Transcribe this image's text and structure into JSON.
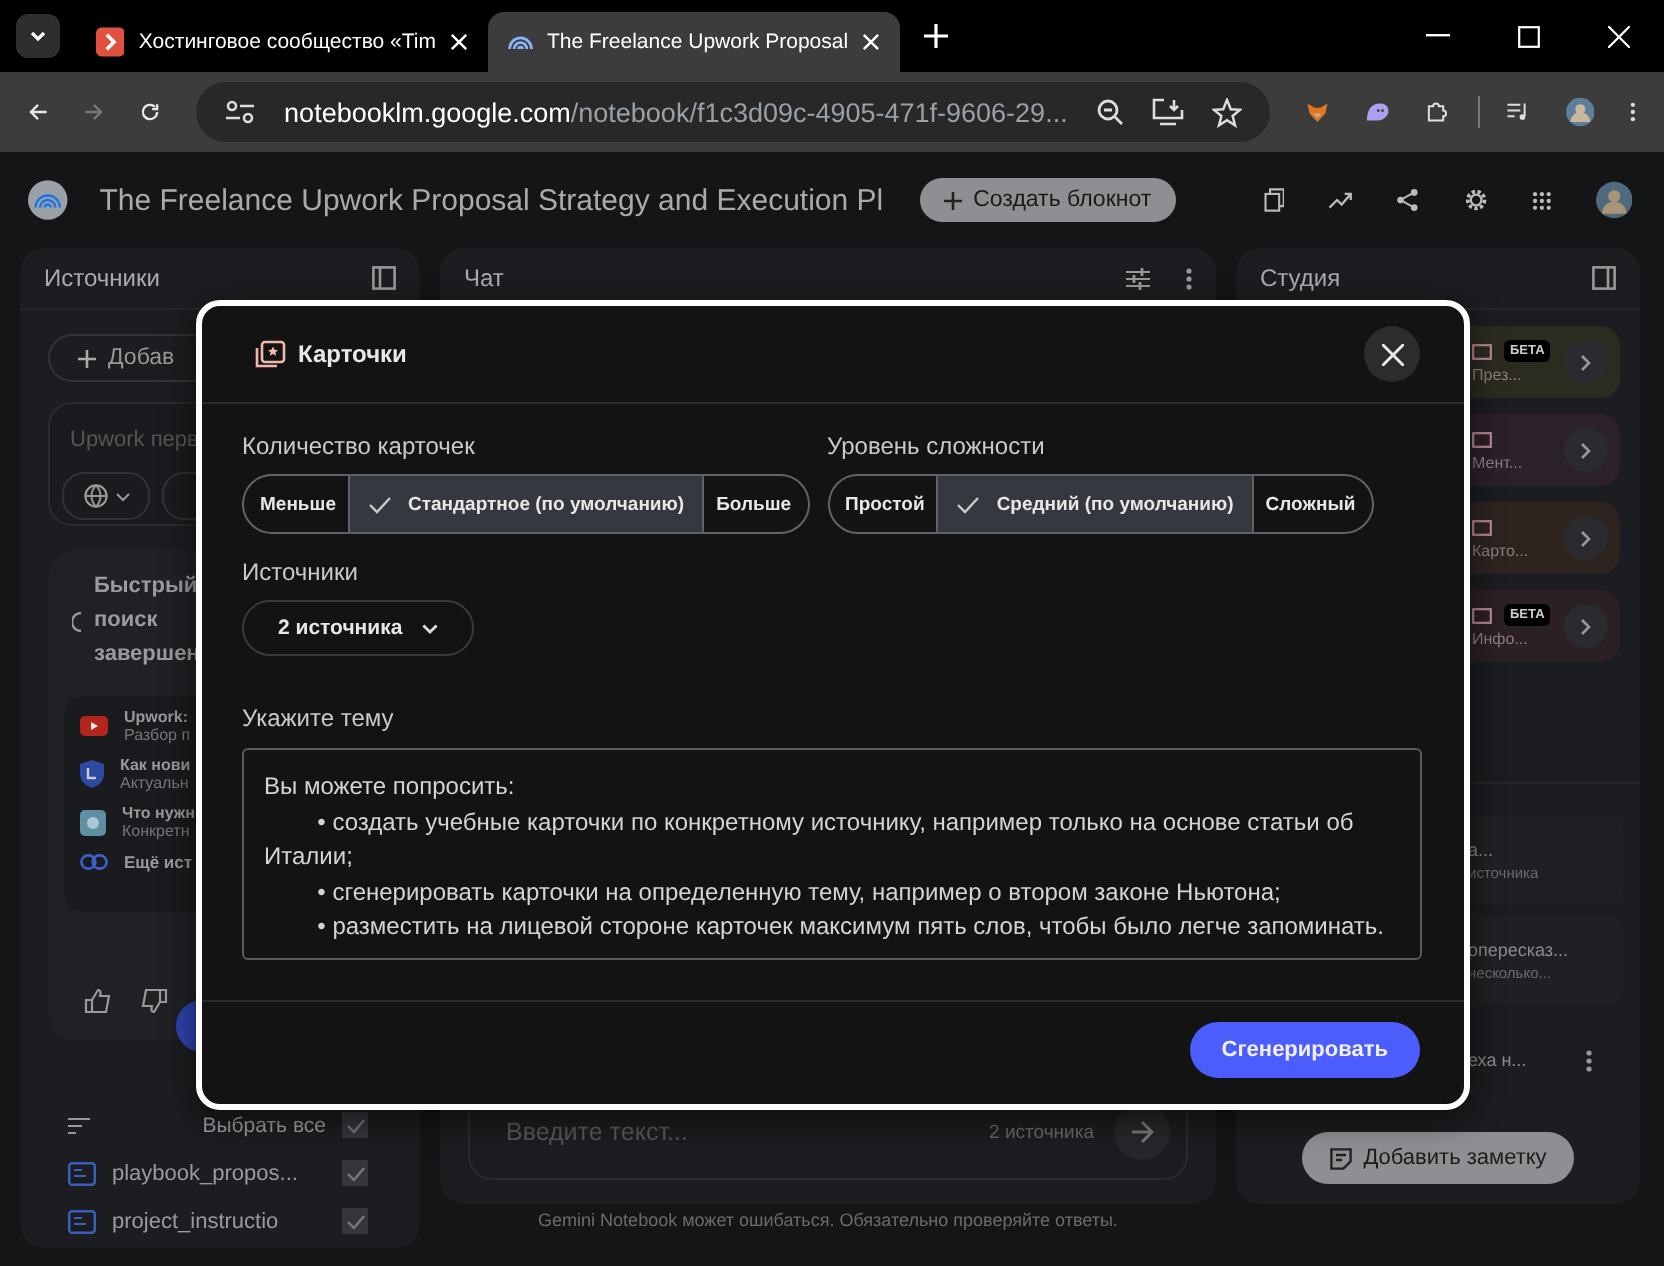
{
  "browser": {
    "tabs": [
      {
        "title": "Хостинговое сообщество «Tim",
        "kind": "site",
        "selected": false
      },
      {
        "title": "The Freelance Upwork Proposal",
        "kind": "notebook",
        "selected": true
      }
    ],
    "url_host": "notebooklm.google.com",
    "url_path": "/notebook/f1c3d09c-4905-471f-9606-29..."
  },
  "header": {
    "title": "The Freelance Upwork Proposal Strategy and Execution Pl",
    "create_button": "Создать блокнот"
  },
  "sources_panel": {
    "title": "Источники",
    "add_button": "Добав",
    "search_placeholder": "Upwork перв",
    "search_status": "Быстрый поиск завершен",
    "results": [
      {
        "kind": "video",
        "title": "Upwork:",
        "subtitle": "Разбор п"
      },
      {
        "kind": "shield",
        "title": "Как нови",
        "subtitle": "Актуальн"
      },
      {
        "kind": "site",
        "title": "Что нужн",
        "subtitle": "Конкретн"
      },
      {
        "kind": "link",
        "title": "Ещё ист"
      }
    ],
    "select_all": {
      "label": "Выбрать все",
      "checked": true
    },
    "files": [
      {
        "name": "playbook_propos...",
        "checked": true
      },
      {
        "name": "project_instructio",
        "checked": true
      }
    ]
  },
  "chat_panel": {
    "title": "Чат",
    "input_placeholder": "Введите текст...",
    "source_count": "2 источника"
  },
  "studio_panel": {
    "title": "Студия",
    "tools": [
      {
        "label": "През...",
        "beta": true,
        "badge": "БЕТА",
        "color": "#2c2b20"
      },
      {
        "label": "Мент...",
        "beta": false,
        "color": "#2b2129"
      },
      {
        "label": "Карто...",
        "beta": false,
        "color": "#2d2420"
      },
      {
        "label": "Инфо...",
        "beta": true,
        "badge": "БЕТА",
        "color": "#2b2024"
      }
    ],
    "notes": [
      {
        "title": "а...",
        "meta": "источника"
      },
      {
        "title": "опересказ...",
        "meta": "несколько..."
      },
      {
        "title": "еха н..."
      }
    ],
    "add_note_button": "Добавить заметку"
  },
  "disclaimer": "Gemini Notebook может ошибаться. Обязательно проверяйте ответы.",
  "modal": {
    "title": "Карточки",
    "count": {
      "label": "Количество карточек",
      "options": [
        {
          "label": "Меньше",
          "selected": false
        },
        {
          "label": "Стандартное (по умолчанию)",
          "selected": true
        },
        {
          "label": "Больше",
          "selected": false
        }
      ]
    },
    "difficulty": {
      "label": "Уровень сложности",
      "options": [
        {
          "label": "Простой",
          "selected": false
        },
        {
          "label": "Средний (по умолчанию)",
          "selected": true
        },
        {
          "label": "Сложный",
          "selected": false
        }
      ]
    },
    "sources": {
      "label": "Источники",
      "value": "2 источника"
    },
    "topic": {
      "label": "Укажите тему",
      "placeholder_intro": "Вы можете попросить:",
      "placeholder_bullets": [
        "• создать учебные карточки по конкретному источнику, например только на основе статьи об Италии;",
        "• сгенерировать карточки на определенную тему, например о втором законе Ньютона;",
        "• разместить на лицевой стороне карточек максимум пять слов, чтобы было легче запоминать."
      ]
    },
    "generate_button": "Сгенерировать"
  }
}
